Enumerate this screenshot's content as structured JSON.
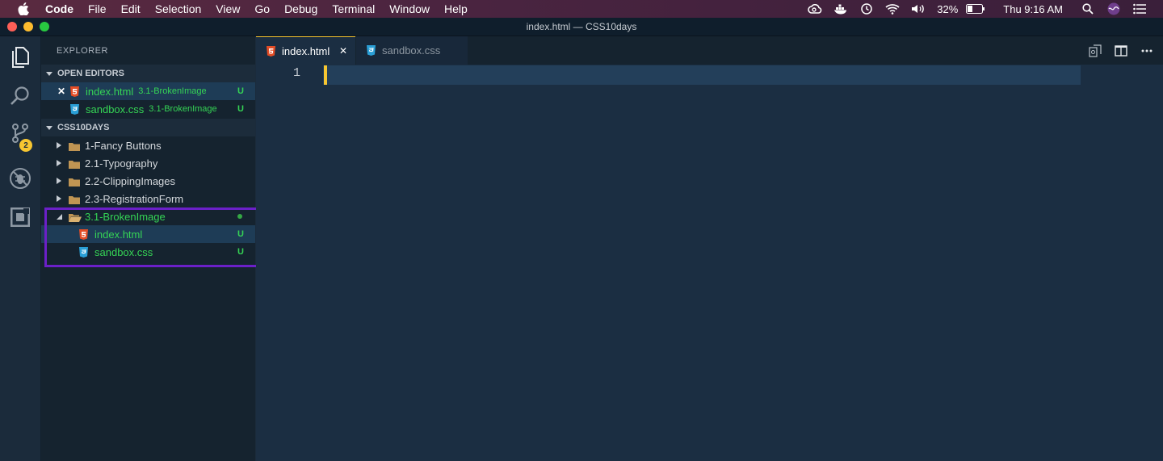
{
  "menubar": {
    "app_name": "Code",
    "items": [
      "File",
      "Edit",
      "Selection",
      "View",
      "Go",
      "Debug",
      "Terminal",
      "Window",
      "Help"
    ],
    "battery": "32%",
    "clock": "Thu 9:16 AM"
  },
  "window": {
    "title": "index.html — CSS10days"
  },
  "activity_bar": {
    "scm_badge": "2"
  },
  "sidebar": {
    "title": "EXPLORER",
    "open_editors_header": "OPEN EDITORS",
    "open_editors": [
      {
        "name": "index.html",
        "path": "3.1-BrokenImage",
        "status": "U"
      },
      {
        "name": "sandbox.css",
        "path": "3.1-BrokenImage",
        "status": "U"
      }
    ],
    "project_header": "CSS10DAYS",
    "folders": [
      {
        "name": "1-Fancy Buttons"
      },
      {
        "name": "2.1-Typography"
      },
      {
        "name": "2.2-ClippingImages"
      },
      {
        "name": "2.3-RegistrationForm"
      },
      {
        "name": "3.1-BrokenImage"
      }
    ],
    "expanded_files": [
      {
        "name": "index.html",
        "status": "U"
      },
      {
        "name": "sandbox.css",
        "status": "U"
      }
    ]
  },
  "tabs": [
    {
      "label": "index.html"
    },
    {
      "label": "sandbox.css"
    }
  ],
  "editor": {
    "line_number": "1"
  },
  "colors": {
    "accent": "#f7c631",
    "git_untracked": "#35d455",
    "highlight_box": "#6b20c8",
    "html_icon": "#e44d26",
    "css_icon": "#2a9fd6"
  }
}
